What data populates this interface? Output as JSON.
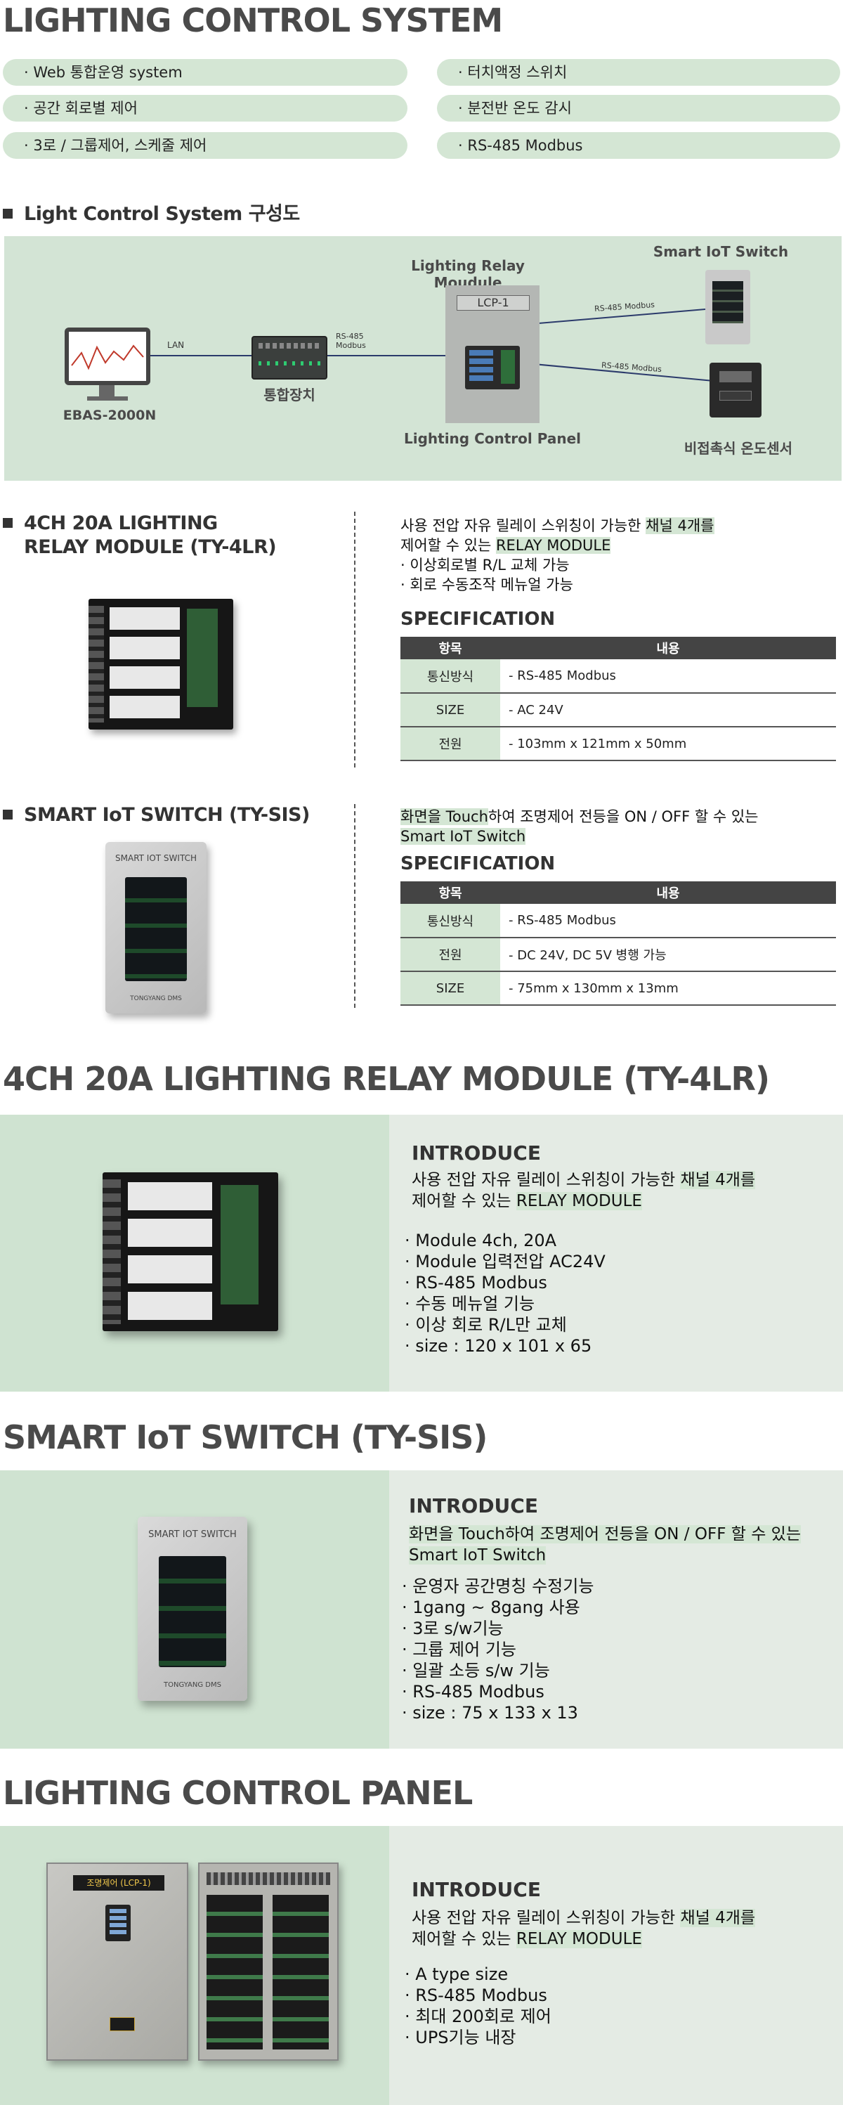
{
  "page_title": "LIGHTING CONTROL SYSTEM",
  "features_left": [
    "· Web 통합운영 system",
    "· 공간 회로별 제어",
    "· 3로 / 그룹제어, 스케줄 제어"
  ],
  "features_right": [
    "· 터치액정 스위치",
    "· 분전반 온도 감시",
    "· RS-485 Modbus"
  ],
  "diagram": {
    "title": "Light Control System 구성도",
    "ebas": "EBAS-2000N",
    "lan": "LAN",
    "integration": "통합장치",
    "rs485_line1": "RS-485",
    "rs485_line2": "Modbus",
    "relay_module": "Lighting Relay Moudule",
    "lcp_tag": "LCP-1",
    "control_panel": "Lighting Control Panel",
    "smart_switch": "Smart IoT Switch",
    "rs485_modbus_a": "RS-485 Modbus",
    "rs485_modbus_b": "RS-485 Modbus",
    "temp_sensor": "비접촉식 온도센서",
    "switch_face": "SMART IOT SWITCH"
  },
  "product1": {
    "title_line1": "4CH 20A LIGHTING",
    "title_line2": "RELAY MODULE (TY-4LR)",
    "desc_a": "사용 전압 자유 릴레이 스위칭이 가능한 ",
    "desc_hl1": "채널 4개를",
    "desc_b": "제어할 수 있는 ",
    "desc_hl2": "RELAY MODULE",
    "bullet1": "· 이상회로별 R/L 교체 가능",
    "bullet2": "· 회로 수동조작 메뉴얼 가능",
    "spec_title": "SPECIFICATION",
    "spec_headers": [
      "항목",
      "내용"
    ],
    "spec_rows": [
      {
        "k": "통신방식",
        "v": "- RS-485 Modbus"
      },
      {
        "k": "SIZE",
        "v": "- AC 24V"
      },
      {
        "k": "전원",
        "v": "- 103mm x 121mm x 50mm"
      }
    ]
  },
  "product2": {
    "title": "SMART IoT SWITCH (TY-SIS)",
    "desc_hl1": "화면을 Touch",
    "desc_a": "하여 조명제어 전등을 ON / OFF 할 수 있는",
    "desc_hl2": "Smart IoT Switch",
    "spec_title": "SPECIFICATION",
    "spec_headers": [
      "항목",
      "내용"
    ],
    "spec_rows": [
      {
        "k": "통신방식",
        "v": "- RS-485 Modbus"
      },
      {
        "k": "전원",
        "v": "- DC 24V, DC 5V 병행 가능"
      },
      {
        "k": "SIZE",
        "v": "- 75mm x 130mm x 13mm"
      }
    ],
    "device_title": "SMART IOT SWITCH",
    "device_brand": "TONGYANG DMS"
  },
  "section_relay": {
    "heading": "4CH 20A LIGHTING RELAY MODULE (TY-4LR)",
    "intro": "INTRODUCE",
    "desc_a": "사용 전압 자유 릴레이 스위칭이 가능한 ",
    "desc_hl1": "채널 4개를",
    "desc_b": "제어할 수 있는 ",
    "desc_hl2": "RELAY MODULE",
    "bullets": [
      "· Module 4ch, 20A",
      "· Module  입력전압 AC24V",
      "· RS-485 Modbus",
      "· 수동 메뉴얼 기능",
      "· 이상 회로 R/L만 교체",
      "· size : 120 x 101 x 65"
    ]
  },
  "section_switch": {
    "heading": "SMART IoT SWITCH (TY-SIS)",
    "intro": "INTRODUCE",
    "desc_hl1": "화면을 Touch",
    "desc_a": "하여 조명제어 전등을 ON / OFF 할 수 있는",
    "desc_hl2": "Smart IoT Switch",
    "bullets": [
      "· 운영자 공간명칭 수정기능",
      "· 1gang ~ 8gang 사용",
      "· 3로 s/w기능",
      "· 그룹 제어 기능",
      "· 일괄 소등 s/w 기능",
      "· RS-485 Modbus",
      "· size : 75 x 133 x 13"
    ],
    "device_title": "SMART IOT SWITCH",
    "device_brand": "TONGYANG DMS"
  },
  "section_panel": {
    "heading": "LIGHTING CONTROL PANEL",
    "intro": "INTRODUCE",
    "desc_a": "사용 전압 자유 릴레이 스위칭이 가능한 ",
    "desc_hl1": "채널 4개를",
    "desc_b": "제어할 수 있는 ",
    "desc_hl2": "RELAY MODULE",
    "bullets": [
      "· A type size",
      "· RS-485 Modbus",
      "· 최대 200회로 제어",
      "· UPS기능 내장"
    ],
    "cabinet_label": "조명제어 (LCP-1)"
  },
  "colors": {
    "accent_green": "#d4e6d4",
    "panel_green": "#cfe3d1",
    "panel_grey": "#e4ebe4",
    "heading": "#4a4a4a",
    "table_head": "#444444"
  }
}
